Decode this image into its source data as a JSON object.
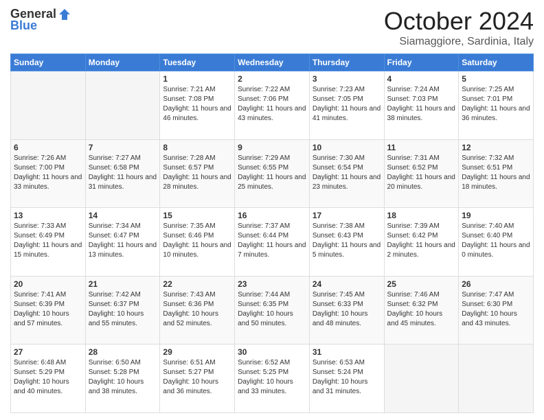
{
  "logo": {
    "general": "General",
    "blue": "Blue"
  },
  "header": {
    "title": "October 2024",
    "subtitle": "Siamaggiore, Sardinia, Italy"
  },
  "weekdays": [
    "Sunday",
    "Monday",
    "Tuesday",
    "Wednesday",
    "Thursday",
    "Friday",
    "Saturday"
  ],
  "weeks": [
    [
      {
        "day": "",
        "sunrise": "",
        "sunset": "",
        "daylight": ""
      },
      {
        "day": "",
        "sunrise": "",
        "sunset": "",
        "daylight": ""
      },
      {
        "day": "1",
        "sunrise": "Sunrise: 7:21 AM",
        "sunset": "Sunset: 7:08 PM",
        "daylight": "Daylight: 11 hours and 46 minutes."
      },
      {
        "day": "2",
        "sunrise": "Sunrise: 7:22 AM",
        "sunset": "Sunset: 7:06 PM",
        "daylight": "Daylight: 11 hours and 43 minutes."
      },
      {
        "day": "3",
        "sunrise": "Sunrise: 7:23 AM",
        "sunset": "Sunset: 7:05 PM",
        "daylight": "Daylight: 11 hours and 41 minutes."
      },
      {
        "day": "4",
        "sunrise": "Sunrise: 7:24 AM",
        "sunset": "Sunset: 7:03 PM",
        "daylight": "Daylight: 11 hours and 38 minutes."
      },
      {
        "day": "5",
        "sunrise": "Sunrise: 7:25 AM",
        "sunset": "Sunset: 7:01 PM",
        "daylight": "Daylight: 11 hours and 36 minutes."
      }
    ],
    [
      {
        "day": "6",
        "sunrise": "Sunrise: 7:26 AM",
        "sunset": "Sunset: 7:00 PM",
        "daylight": "Daylight: 11 hours and 33 minutes."
      },
      {
        "day": "7",
        "sunrise": "Sunrise: 7:27 AM",
        "sunset": "Sunset: 6:58 PM",
        "daylight": "Daylight: 11 hours and 31 minutes."
      },
      {
        "day": "8",
        "sunrise": "Sunrise: 7:28 AM",
        "sunset": "Sunset: 6:57 PM",
        "daylight": "Daylight: 11 hours and 28 minutes."
      },
      {
        "day": "9",
        "sunrise": "Sunrise: 7:29 AM",
        "sunset": "Sunset: 6:55 PM",
        "daylight": "Daylight: 11 hours and 25 minutes."
      },
      {
        "day": "10",
        "sunrise": "Sunrise: 7:30 AM",
        "sunset": "Sunset: 6:54 PM",
        "daylight": "Daylight: 11 hours and 23 minutes."
      },
      {
        "day": "11",
        "sunrise": "Sunrise: 7:31 AM",
        "sunset": "Sunset: 6:52 PM",
        "daylight": "Daylight: 11 hours and 20 minutes."
      },
      {
        "day": "12",
        "sunrise": "Sunrise: 7:32 AM",
        "sunset": "Sunset: 6:51 PM",
        "daylight": "Daylight: 11 hours and 18 minutes."
      }
    ],
    [
      {
        "day": "13",
        "sunrise": "Sunrise: 7:33 AM",
        "sunset": "Sunset: 6:49 PM",
        "daylight": "Daylight: 11 hours and 15 minutes."
      },
      {
        "day": "14",
        "sunrise": "Sunrise: 7:34 AM",
        "sunset": "Sunset: 6:47 PM",
        "daylight": "Daylight: 11 hours and 13 minutes."
      },
      {
        "day": "15",
        "sunrise": "Sunrise: 7:35 AM",
        "sunset": "Sunset: 6:46 PM",
        "daylight": "Daylight: 11 hours and 10 minutes."
      },
      {
        "day": "16",
        "sunrise": "Sunrise: 7:37 AM",
        "sunset": "Sunset: 6:44 PM",
        "daylight": "Daylight: 11 hours and 7 minutes."
      },
      {
        "day": "17",
        "sunrise": "Sunrise: 7:38 AM",
        "sunset": "Sunset: 6:43 PM",
        "daylight": "Daylight: 11 hours and 5 minutes."
      },
      {
        "day": "18",
        "sunrise": "Sunrise: 7:39 AM",
        "sunset": "Sunset: 6:42 PM",
        "daylight": "Daylight: 11 hours and 2 minutes."
      },
      {
        "day": "19",
        "sunrise": "Sunrise: 7:40 AM",
        "sunset": "Sunset: 6:40 PM",
        "daylight": "Daylight: 11 hours and 0 minutes."
      }
    ],
    [
      {
        "day": "20",
        "sunrise": "Sunrise: 7:41 AM",
        "sunset": "Sunset: 6:39 PM",
        "daylight": "Daylight: 10 hours and 57 minutes."
      },
      {
        "day": "21",
        "sunrise": "Sunrise: 7:42 AM",
        "sunset": "Sunset: 6:37 PM",
        "daylight": "Daylight: 10 hours and 55 minutes."
      },
      {
        "day": "22",
        "sunrise": "Sunrise: 7:43 AM",
        "sunset": "Sunset: 6:36 PM",
        "daylight": "Daylight: 10 hours and 52 minutes."
      },
      {
        "day": "23",
        "sunrise": "Sunrise: 7:44 AM",
        "sunset": "Sunset: 6:35 PM",
        "daylight": "Daylight: 10 hours and 50 minutes."
      },
      {
        "day": "24",
        "sunrise": "Sunrise: 7:45 AM",
        "sunset": "Sunset: 6:33 PM",
        "daylight": "Daylight: 10 hours and 48 minutes."
      },
      {
        "day": "25",
        "sunrise": "Sunrise: 7:46 AM",
        "sunset": "Sunset: 6:32 PM",
        "daylight": "Daylight: 10 hours and 45 minutes."
      },
      {
        "day": "26",
        "sunrise": "Sunrise: 7:47 AM",
        "sunset": "Sunset: 6:30 PM",
        "daylight": "Daylight: 10 hours and 43 minutes."
      }
    ],
    [
      {
        "day": "27",
        "sunrise": "Sunrise: 6:48 AM",
        "sunset": "Sunset: 5:29 PM",
        "daylight": "Daylight: 10 hours and 40 minutes."
      },
      {
        "day": "28",
        "sunrise": "Sunrise: 6:50 AM",
        "sunset": "Sunset: 5:28 PM",
        "daylight": "Daylight: 10 hours and 38 minutes."
      },
      {
        "day": "29",
        "sunrise": "Sunrise: 6:51 AM",
        "sunset": "Sunset: 5:27 PM",
        "daylight": "Daylight: 10 hours and 36 minutes."
      },
      {
        "day": "30",
        "sunrise": "Sunrise: 6:52 AM",
        "sunset": "Sunset: 5:25 PM",
        "daylight": "Daylight: 10 hours and 33 minutes."
      },
      {
        "day": "31",
        "sunrise": "Sunrise: 6:53 AM",
        "sunset": "Sunset: 5:24 PM",
        "daylight": "Daylight: 10 hours and 31 minutes."
      },
      {
        "day": "",
        "sunrise": "",
        "sunset": "",
        "daylight": ""
      },
      {
        "day": "",
        "sunrise": "",
        "sunset": "",
        "daylight": ""
      }
    ]
  ]
}
